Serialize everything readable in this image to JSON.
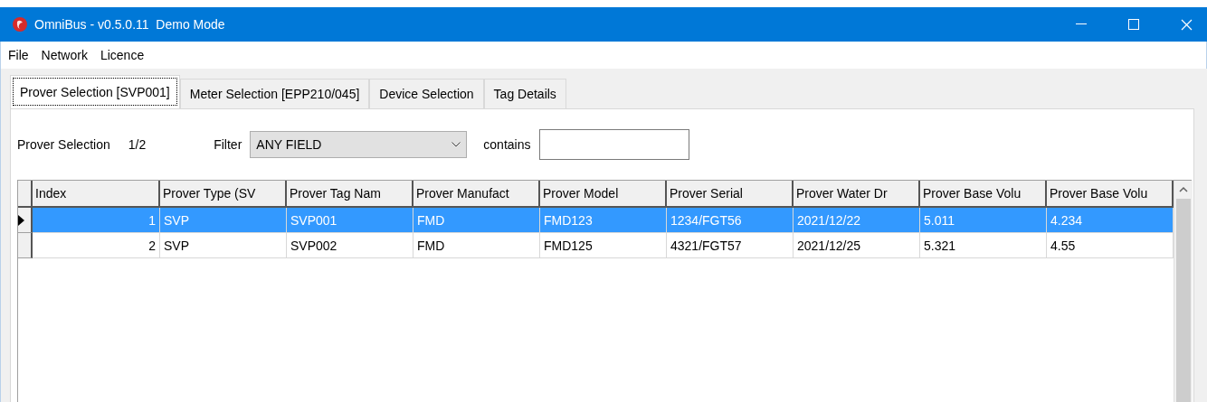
{
  "window": {
    "title": "OmniBus - v0.5.0.11  Demo Mode"
  },
  "menu": [
    "File",
    "Network",
    "Licence"
  ],
  "tabs": [
    {
      "label": "Prover Selection [SVP001]",
      "selected": true
    },
    {
      "label": "Meter Selection [EPP210/045]",
      "selected": false
    },
    {
      "label": "Device Selection",
      "selected": false
    },
    {
      "label": "Tag Details",
      "selected": false
    }
  ],
  "selection": {
    "label": "Prover Selection",
    "count": "1/2"
  },
  "filter": {
    "label": "Filter",
    "value": "ANY FIELD",
    "contains_label": "contains"
  },
  "table": {
    "columns": [
      "Index",
      "Prover Type (SV",
      "Prover Tag Nam",
      "Prover Manufact",
      "Prover Model",
      "Prover Serial",
      "Prover Water Dr",
      "Prover Base Volu",
      "Prover Base Volu"
    ],
    "rows": [
      {
        "selected": true,
        "cells": [
          "1",
          "SVP",
          "SVP001",
          "FMD",
          "FMD123",
          "1234/FGT56",
          "2021/12/22",
          "5.011",
          "4.234"
        ]
      },
      {
        "selected": false,
        "cells": [
          "2",
          "SVP",
          "SVP002",
          "FMD",
          "FMD125",
          "4321/FGT57",
          "2021/12/25",
          "5.321",
          "4.55"
        ]
      }
    ]
  }
}
